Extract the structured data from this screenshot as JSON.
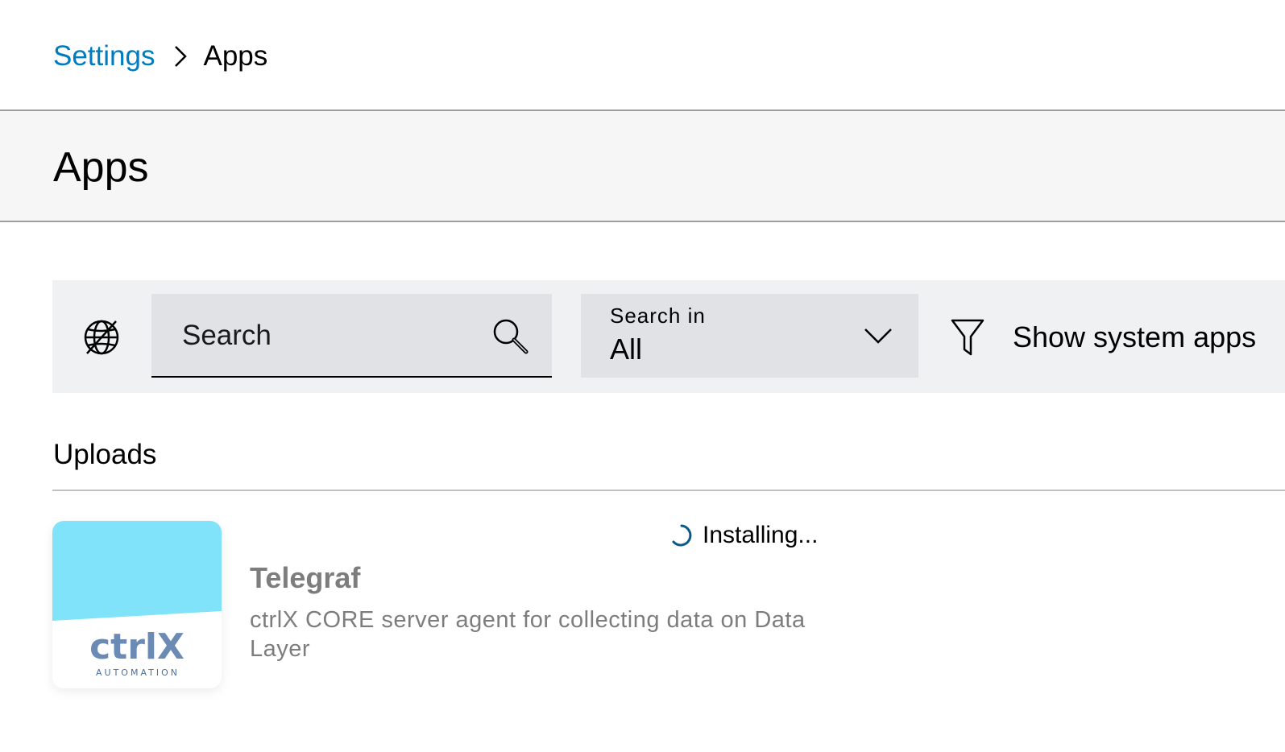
{
  "breadcrumb": {
    "parent": "Settings",
    "current": "Apps"
  },
  "page": {
    "title": "Apps"
  },
  "toolbar": {
    "search": {
      "placeholder": "Search",
      "value": ""
    },
    "search_in": {
      "label": "Search in",
      "value": "All"
    },
    "filter_label": "Show system apps"
  },
  "uploads": {
    "title": "Uploads",
    "items": [
      {
        "name": "Telegraf",
        "description": "ctrlX CORE server agent for collecting data on Data Layer",
        "status": "Installing...",
        "logo": {
          "wordmark": "ctrlX",
          "tagline": "AUTOMATION"
        }
      }
    ]
  },
  "colors": {
    "link": "#007bc0",
    "tile_top": "#80e3fa",
    "spinner": "#0a5a8a",
    "muted_text": "#7d7d7d"
  },
  "icons": {
    "breadcrumb_separator": "chevron-right-icon",
    "globe": "globe-off-icon",
    "search": "search-icon",
    "select": "chevron-down-icon",
    "filter": "filter-icon",
    "status": "spinner-icon"
  }
}
